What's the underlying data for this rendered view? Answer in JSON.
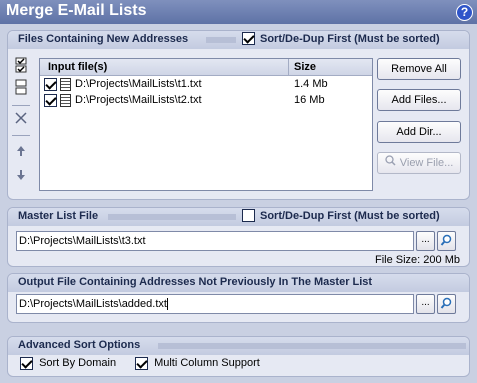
{
  "window": {
    "title": "Merge E-Mail Lists",
    "help_label": "?"
  },
  "new_files": {
    "title": "Files Containing New Addresses",
    "sort_label": "Sort/De-Dup First (Must be sorted)",
    "sort_checked": true,
    "columns": [
      "Input file(s)",
      "Size"
    ],
    "files": [
      {
        "path": "D:\\Projects\\MailLists\\t1.txt",
        "size": "1.4 Mb",
        "checked": true
      },
      {
        "path": "D:\\Projects\\MailLists\\t2.txt",
        "size": "16 Mb",
        "checked": true
      }
    ],
    "buttons": {
      "remove_all": "Remove All",
      "add_files": "Add Files...",
      "add_dir": "Add Dir...",
      "view_file": "View File..."
    }
  },
  "master": {
    "title": "Master List File",
    "sort_label": "Sort/De-Dup First (Must be sorted)",
    "sort_checked": false,
    "path": "D:\\Projects\\MailLists\\t3.txt",
    "browse_label": "...",
    "file_size": "File Size: 200 Mb"
  },
  "output": {
    "title": "Output File Containing Addresses Not Previously In The Master List",
    "path": "D:\\Projects\\MailLists\\added.txt",
    "browse_label": "..."
  },
  "advanced": {
    "title": "Advanced Sort Options",
    "sort_by_domain": "Sort By Domain",
    "sort_by_domain_checked": true,
    "multi_column": "Multi Column Support",
    "multi_column_checked": true
  }
}
